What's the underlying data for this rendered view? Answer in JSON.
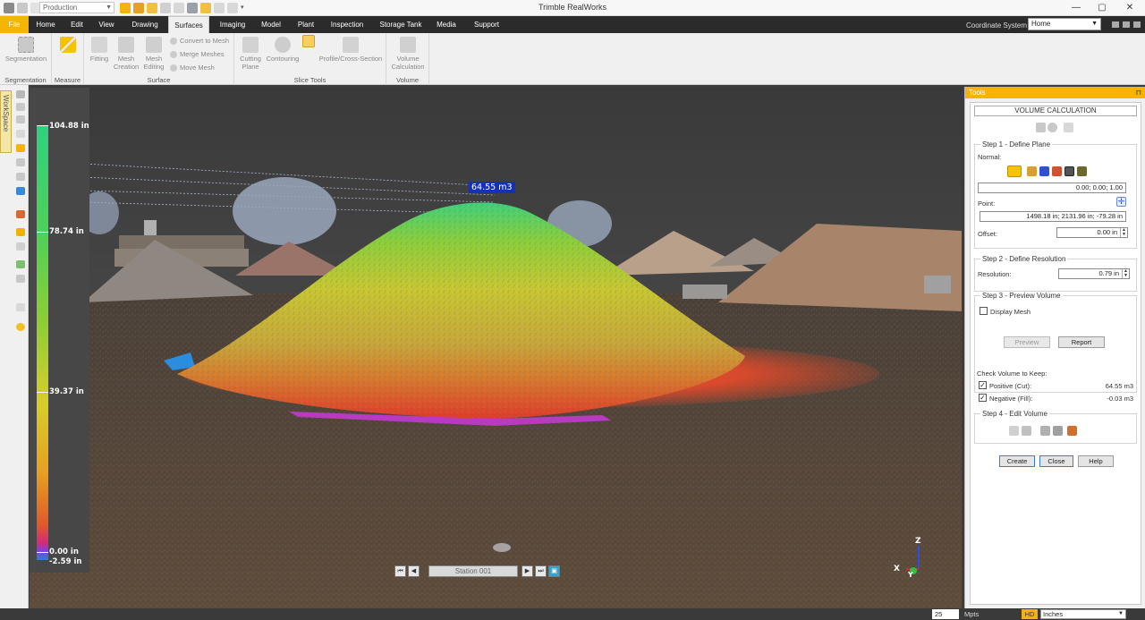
{
  "window": {
    "title": "Trimble RealWorks",
    "project": "Production"
  },
  "menu": {
    "tabs": [
      "File",
      "Home",
      "Edit",
      "View",
      "Drawing",
      "Surfaces",
      "Imaging",
      "Model",
      "Plant",
      "Inspection",
      "Storage Tank",
      "Media",
      "Support"
    ],
    "active": "Surfaces",
    "coordinate_label": "Coordinate System",
    "coordinate_value": "Home"
  },
  "ribbon": {
    "segmentation": {
      "button": "Segmentation",
      "group": "Segmentation"
    },
    "measure": {
      "group": "Measure"
    },
    "surface": {
      "fitting": "Fitting",
      "mesh_creation_1": "Mesh",
      "mesh_creation_2": "Creation",
      "mesh_editing_1": "Mesh",
      "mesh_editing_2": "Editing",
      "convert": "Convert to Mesh",
      "merge": "Merge Meshes",
      "move": "Move Mesh",
      "group": "Surface"
    },
    "slice": {
      "cutting_1": "Cutting",
      "cutting_2": "Plane",
      "contouring": "Contouring",
      "profile": "Profile/Cross-Section",
      "group": "Slice Tools"
    },
    "volume": {
      "btn_1": "Volume",
      "btn_2": "Calculation",
      "group": "Volume"
    }
  },
  "left_panel": {
    "workspace_tab": "WorkSpace"
  },
  "legend": {
    "labels": [
      {
        "text": "104.88 in",
        "value": 104.88
      },
      {
        "text": "78.74 in",
        "value": 78.74
      },
      {
        "text": "39.37 in",
        "value": 39.37
      },
      {
        "text": "0.00 in",
        "value": 0.0
      },
      {
        "text": "-2.59 in",
        "value": -2.59
      }
    ]
  },
  "viewport": {
    "volume_label": "64.55 m3",
    "station": "Station 001",
    "axes": {
      "x": "X",
      "y": "Y",
      "z": "Z"
    }
  },
  "tools": {
    "header": "Tools",
    "title": "VOLUME CALCULATION",
    "step1": {
      "title": "Step 1 - Define Plane",
      "normal_label": "Normal:",
      "normal_value": "0.00; 0.00; 1.00",
      "point_label": "Point:",
      "point_value": "1498.18 in; 2131.96 in; -79.28 in",
      "offset_label": "Offset:",
      "offset_value": "0.00 in"
    },
    "step2": {
      "title": "Step 2 - Define Resolution",
      "resolution_label": "Resolution:",
      "resolution_value": "0.79 in"
    },
    "step3": {
      "title": "Step 3 - Preview Volume",
      "display_mesh": "Display Mesh",
      "preview": "Preview",
      "report": "Report",
      "check_label": "Check Volume to Keep:",
      "positive_label": "Positive (Cut):",
      "positive_value": "64.55 m3",
      "negative_label": "Negative (Fill):",
      "negative_value": "-0.03 m3"
    },
    "step4": {
      "title": "Step 4 - Edit Volume"
    },
    "buttons": {
      "create": "Create",
      "close": "Close",
      "help": "Help"
    }
  },
  "status": {
    "points": "25",
    "points_unit": "Mpts",
    "hd": "HD",
    "units": "Inches"
  }
}
